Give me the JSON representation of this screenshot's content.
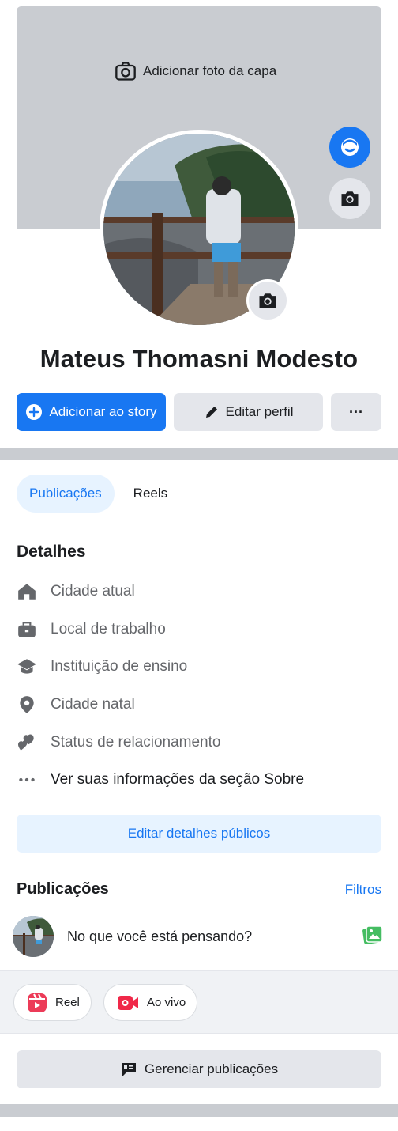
{
  "cover": {
    "add_photo_label": "Adicionar foto da capa"
  },
  "profile": {
    "name": "Mateus Thomasni Modesto"
  },
  "actions": {
    "story_label": "Adicionar ao story",
    "edit_label": "Editar perfil",
    "more_label": "···"
  },
  "tabs": [
    {
      "label": "Publicações",
      "active": true
    },
    {
      "label": "Reels",
      "active": false
    }
  ],
  "details": {
    "title": "Detalhes",
    "items": [
      {
        "icon": "home-icon",
        "label": "Cidade atual"
      },
      {
        "icon": "briefcase-icon",
        "label": "Local de trabalho"
      },
      {
        "icon": "graduation-cap-icon",
        "label": "Instituição de ensino"
      },
      {
        "icon": "location-pin-icon",
        "label": "Cidade natal"
      },
      {
        "icon": "hearts-icon",
        "label": "Status de relacionamento"
      },
      {
        "icon": "more-dots-icon",
        "label": "Ver suas informações da seção Sobre"
      }
    ],
    "edit_button_label": "Editar detalhes públicos"
  },
  "posts": {
    "title": "Publicações",
    "filters_label": "Filtros",
    "composer_placeholder": "No que você está pensando?",
    "reel_label": "Reel",
    "live_label": "Ao vivo",
    "manage_label": "Gerenciar publicações"
  },
  "colors": {
    "brand_blue": "#1877f2",
    "light_blue": "#e7f3ff",
    "button_gray": "#e4e6eb",
    "cover_gray": "#c9ccd1"
  }
}
